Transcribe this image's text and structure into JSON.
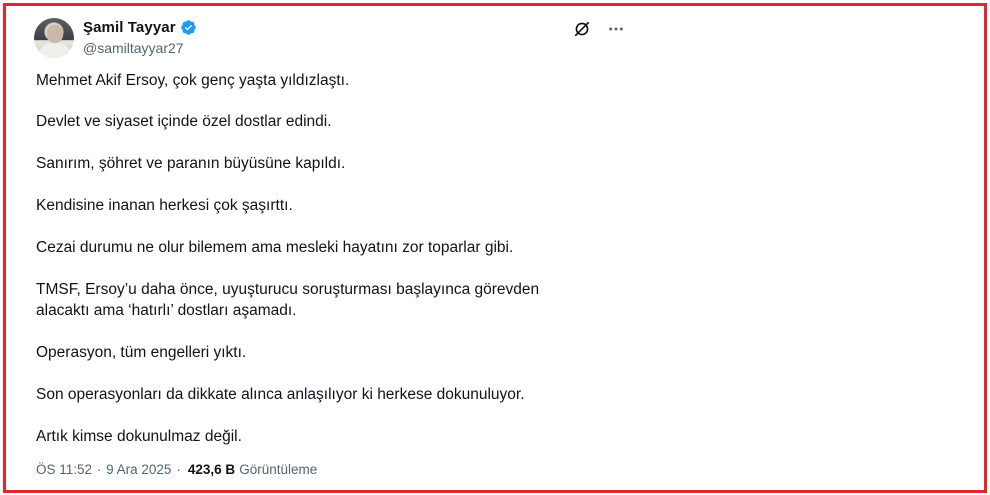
{
  "author": {
    "display_name": "Şamil Tayyar",
    "handle": "@samiltayyar27",
    "verified_color": "#1d9bf0"
  },
  "icons": {
    "grok": "grok-icon",
    "more": "more-icon",
    "verified": "verified-badge-icon",
    "avatar": "avatar"
  },
  "paragraphs": [
    "Mehmet Akif Ersoy, çok genç yaşta yıldızlaştı.",
    "Devlet ve siyaset içinde özel dostlar edindi.",
    "Sanırım, şöhret ve paranın büyüsüne kapıldı.",
    "Kendisine inanan herkesi çok şaşırttı.",
    "Cezai durumu ne olur bilemem ama mesleki hayatını zor toparlar gibi.",
    "TMSF, Ersoy’u daha önce, uyuşturucu soruşturması başlayınca görevden",
    "alacaktı ama ‘hatırlı’ dostları aşamadı.",
    "Operasyon, tüm engelleri yıktı.",
    "Son operasyonları da dikkate alınca anlaşılıyor ki herkese dokunuluyor.",
    "Artık kimse dokunulmaz değil."
  ],
  "meta": {
    "time": "ÖS 11:52",
    "separator": "·",
    "date": "9 Ara 2025",
    "views_count": "423,6 B",
    "views_label": "Görüntüleme"
  },
  "colors": {
    "frame_border": "#e3262d",
    "text": "#0f1419",
    "secondary_text": "#536471"
  }
}
